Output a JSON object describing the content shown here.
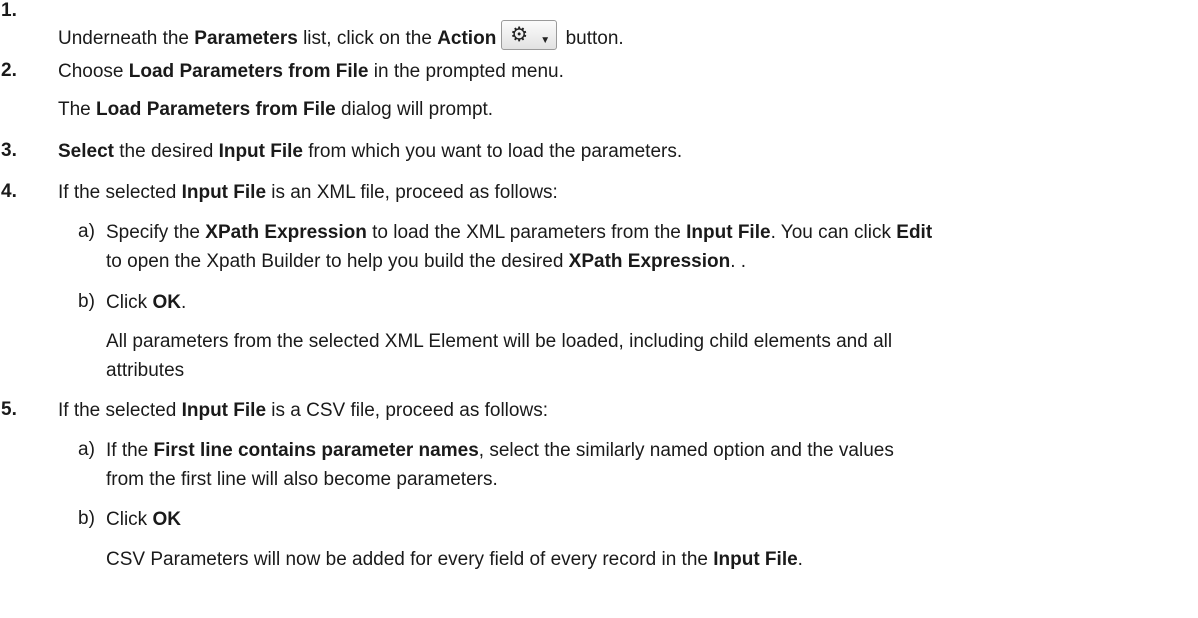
{
  "steps": {
    "s1": {
      "num": "1.",
      "t1": "Underneath the ",
      "b1": "Parameters",
      "t2": " list, click on the ",
      "b2": "Action",
      "t3": " button.",
      "action_icon": "gear-icon",
      "caret_icon": "caret-down-icon"
    },
    "s2": {
      "num": "2.",
      "t1": "Choose ",
      "b1": "Load Parameters from File",
      "t2": " in the prompted menu.",
      "r1": "The ",
      "rb1": "Load Parameters from File",
      "r2": " dialog will prompt."
    },
    "s3": {
      "num": "3.",
      "b1": "Select",
      "t1": " the desired ",
      "b2": "Input File",
      "t2": " from which you want to load the parameters."
    },
    "s4": {
      "num": "4.",
      "t1": "If the selected ",
      "b1": "Input File",
      "t2": " is an XML file, proceed as follows:",
      "a": {
        "label": "a)",
        "l1t1": "Specify the ",
        "l1b1": "XPath Expression",
        "l1t2": " to load the XML parameters from the ",
        "l1b2": "Input File",
        "l1t3": ". You can click ",
        "l1b3": "Edit",
        "l2t1": "to open the Xpath Builder to help you build the desired ",
        "l2b1": "XPath Expression",
        "l2t2": ". ."
      },
      "b": {
        "label": "b)",
        "t1": "Click ",
        "b1": "OK",
        "t2": ".",
        "r1": "All parameters from the selected XML Element will be loaded, including child elements and all",
        "r2": "attributes"
      }
    },
    "s5": {
      "num": "5.",
      "t1": "If the selected ",
      "b1": "Input File",
      "t2": " is a CSV file, proceed as follows:",
      "a": {
        "label": "a)",
        "l1t1": "If the ",
        "l1b1": "First line contains parameter names",
        "l1t2": ", select the similarly named option and the values",
        "l2": "from the first line will also become parameters."
      },
      "b": {
        "label": "b)",
        "t1": "Click ",
        "b1": "OK",
        "r1": "CSV Parameters will now be added for every field of every record in the ",
        "rb1": "Input File",
        "r2": "."
      }
    }
  }
}
